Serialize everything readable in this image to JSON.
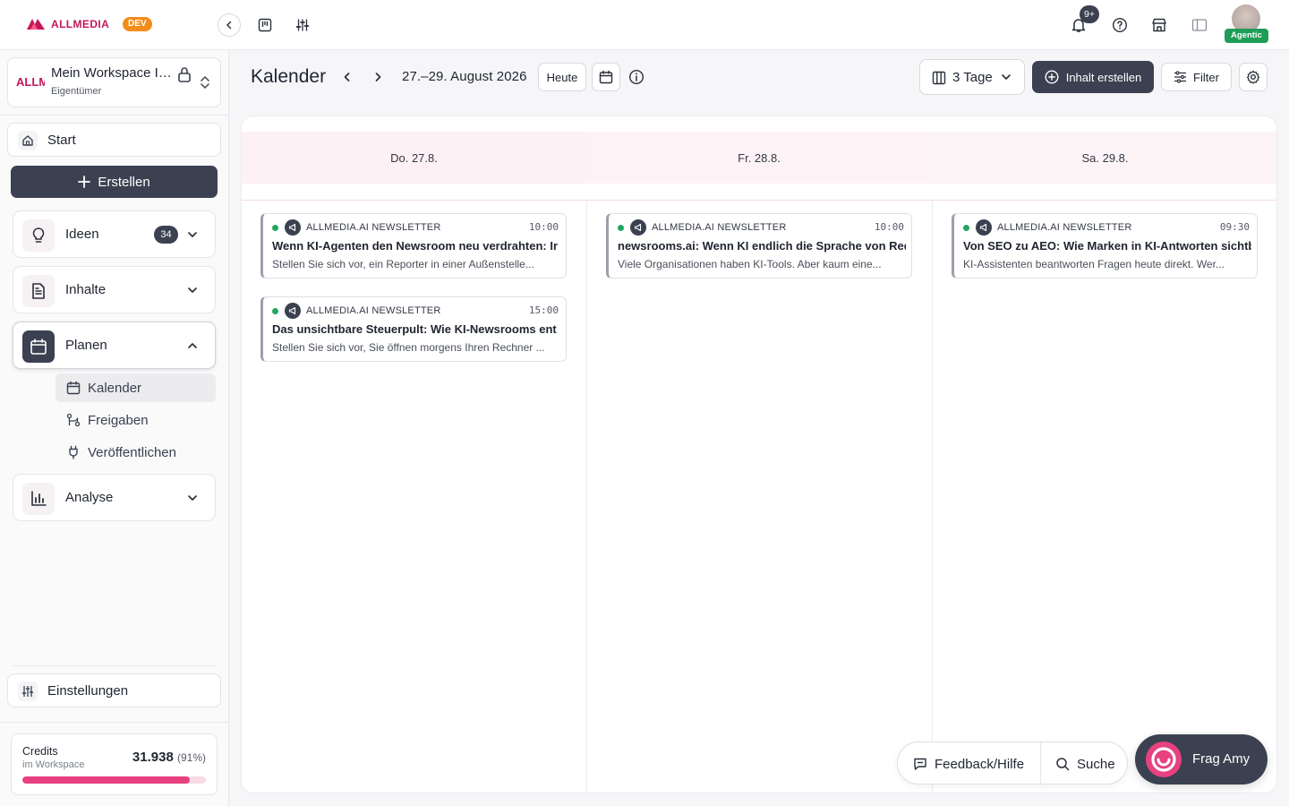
{
  "brand": {
    "name": "ALLMEDIA",
    "env_badge": "DEV"
  },
  "workspace": {
    "logo_text": "ALLM",
    "name": "Mein Workspace Is...",
    "role": "Eigentümer"
  },
  "sidebar": {
    "start_label": "Start",
    "create_label": "Erstellen",
    "groups": [
      {
        "label": "Ideen",
        "badge": "34",
        "icon": "lightbulb-icon",
        "expanded": false
      },
      {
        "label": "Inhalte",
        "icon": "document-icon",
        "expanded": false
      },
      {
        "label": "Planen",
        "icon": "calendar-icon",
        "expanded": true
      },
      {
        "label": "Analyse",
        "icon": "bar-chart-icon",
        "expanded": false
      }
    ],
    "planen_items": [
      {
        "label": "Kalender",
        "icon": "calendar-icon",
        "active": true
      },
      {
        "label": "Freigaben",
        "icon": "approval-flow-icon"
      },
      {
        "label": "Veröffentlichen",
        "icon": "plug-icon"
      }
    ],
    "settings_label": "Einstellungen",
    "credits": {
      "label": "Credits",
      "sublabel": "im Workspace",
      "value": "31.938",
      "percent_text": "(91%)",
      "percent": 91
    }
  },
  "topbar": {
    "notifications_badge": "9+",
    "agentic_badge": "Agentic"
  },
  "header": {
    "title": "Kalender",
    "date_range": "27.–29. August 2026",
    "today_label": "Heute",
    "view_select": "3 Tage",
    "create_content_label": "Inhalt erstellen",
    "filter_label": "Filter"
  },
  "calendar": {
    "days": [
      {
        "label": "Do. 27.8."
      },
      {
        "label": "Fr. 28.8."
      },
      {
        "label": "Sa. 29.8."
      }
    ],
    "events": [
      {
        "day": 0,
        "slot": 0,
        "channel": "ALLMEDIA.AI NEWSLETTER",
        "time": "10:00",
        "title": "Wenn KI-Agenten den Newsroom neu verdrahten: Ir",
        "desc": "Stellen Sie sich vor, ein Reporter in einer Außenstelle..."
      },
      {
        "day": 0,
        "slot": 1,
        "channel": "ALLMEDIA.AI NEWSLETTER",
        "time": "15:00",
        "title": "Das unsichtbare Steuerpult: Wie KI-Newsrooms ent",
        "desc": "Stellen Sie sich vor, Sie öffnen morgens Ihren Rechner ..."
      },
      {
        "day": 1,
        "slot": 0,
        "channel": "ALLMEDIA.AI NEWSLETTER",
        "time": "10:00",
        "title": "newsrooms.ai: Wenn KI endlich die Sprache von Red",
        "desc": "Viele Organisationen haben KI-Tools. Aber kaum eine..."
      },
      {
        "day": 2,
        "slot": 0,
        "channel": "ALLMEDIA.AI NEWSLETTER",
        "time": "09:30",
        "title": "Von SEO zu AEO: Wie Marken in KI-Antworten sichtb",
        "desc": "KI-Assistenten beantworten Fragen heute direkt. Wer..."
      }
    ]
  },
  "floating": {
    "feedback_label": "Feedback/Hilfe",
    "search_label": "Suche",
    "amy_label": "Frag Amy"
  },
  "colors": {
    "accent": "#e8417f",
    "dark": "#3b4150",
    "brand": "#c2185b",
    "status_green": "#22a760"
  }
}
